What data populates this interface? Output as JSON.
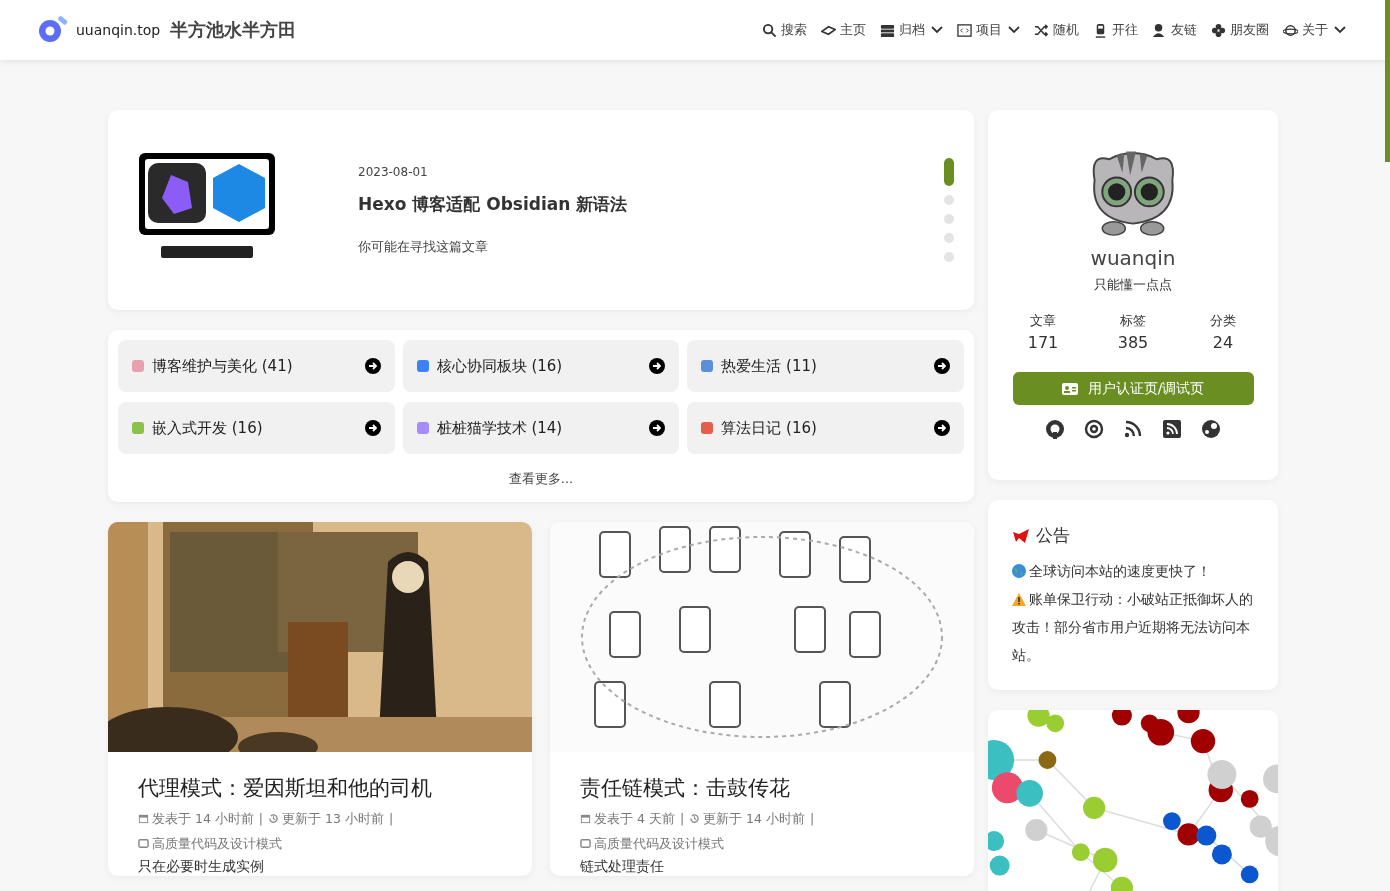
{
  "site": {
    "domain": "uuanqin.top",
    "title": "半方池水半方田"
  },
  "nav": [
    {
      "label": "搜索",
      "has_menu": false
    },
    {
      "label": "主页",
      "has_menu": false
    },
    {
      "label": "归档",
      "has_menu": true
    },
    {
      "label": "项目",
      "has_menu": true
    },
    {
      "label": "随机",
      "has_menu": false
    },
    {
      "label": "开往",
      "has_menu": false
    },
    {
      "label": "友链",
      "has_menu": false
    },
    {
      "label": "朋友圈",
      "has_menu": false
    },
    {
      "label": "关于",
      "has_menu": true
    }
  ],
  "featured": {
    "date": "2023-08-01",
    "title": "Hexo 博客适配 Obsidian 新语法",
    "subtitle": "你可能在寻找这篇文章",
    "dots": [
      {
        "selected": true
      },
      {
        "selected": false
      },
      {
        "selected": false
      },
      {
        "selected": false
      },
      {
        "selected": false
      }
    ]
  },
  "categories": [
    {
      "label": "博客维护与美化 (41)",
      "color": "#e8a0b0"
    },
    {
      "label": "核心协同板块 (16)",
      "color": "#3b82f6"
    },
    {
      "label": "热爱生活 (11)",
      "color": "#5b8fd8"
    },
    {
      "label": "嵌入式开发 (16)",
      "color": "#8bc34a"
    },
    {
      "label": "桩桩猫学技术 (14)",
      "color": "#a78bfa"
    },
    {
      "label": "算法日记 (16)",
      "color": "#e85d4a"
    }
  ],
  "more_link": "查看更多...",
  "posts": [
    {
      "title": "代理模式：爱因斯坦和他的司机",
      "meta": [
        "发表于 14 小时前",
        "|",
        "更新于 13 小时前",
        "|",
        "高质量代码及设计模式"
      ],
      "excerpt": "只在必要时生成实例"
    },
    {
      "title": "责任链模式：击鼓传花",
      "meta": [
        "发表于 4 天前",
        "|",
        "更新于 14 小时前",
        "|",
        "高质量代码及设计模式"
      ],
      "excerpt": "链式处理责任"
    }
  ],
  "profile": {
    "name": "wuanqin",
    "bio": "只能懂一点点",
    "stats": [
      {
        "label": "文章",
        "value": "171"
      },
      {
        "label": "标签",
        "value": "385"
      },
      {
        "label": "分类",
        "value": "24"
      }
    ],
    "button": "用户认证页/调试页"
  },
  "announcement": {
    "title": "公告",
    "lines": [
      "全球访问本站的速度更快了！",
      "账单保卫行动：小破站正抵御坏人的攻击！部分省市用户近期将无法访问本站。"
    ]
  }
}
